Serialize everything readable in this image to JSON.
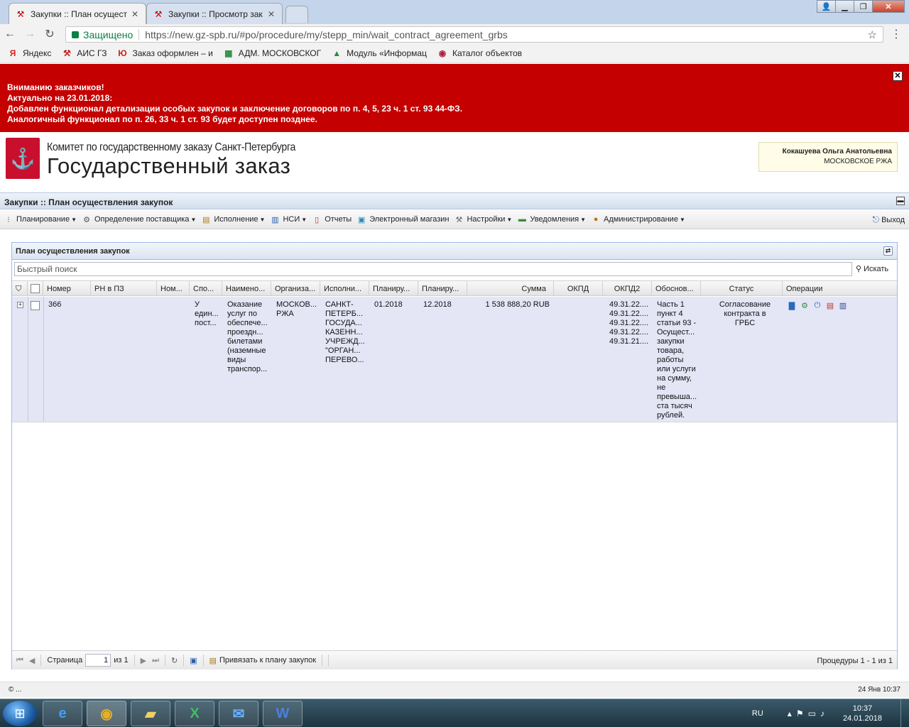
{
  "browser": {
    "tabs": [
      {
        "title": "Закупки :: План осущест",
        "icon": "tools-icon",
        "active": true
      },
      {
        "title": "Закупки :: Просмотр зак",
        "icon": "tools-icon",
        "active": false
      }
    ],
    "secure_label": "Защищено",
    "url": "https://new.gz-spb.ru/#po/procedure/my/stepp_min/wait_contract_agreement_grbs",
    "bookmarks": [
      {
        "label": "Яндекс",
        "icon": "yandex-icon",
        "glyph": "Я",
        "color": "#e02020"
      },
      {
        "label": "АИС ГЗ",
        "icon": "tools-icon",
        "glyph": "⚒",
        "color": "#c02020"
      },
      {
        "label": "Заказ оформлен – и",
        "icon": "yu-icon",
        "glyph": "Ю",
        "color": "#d02020"
      },
      {
        "label": "АДМ. МОСКОВСКОГ",
        "icon": "sheet-icon",
        "glyph": "▦",
        "color": "#2a8a3a"
      },
      {
        "label": "Модуль «Информац",
        "icon": "drive-icon",
        "glyph": "▲",
        "color": "#2a8a3a"
      },
      {
        "label": "Каталог объектов",
        "icon": "catalog-icon",
        "glyph": "◉",
        "color": "#b02040"
      }
    ]
  },
  "banner": {
    "line1": "Вниманию заказчиков!",
    "line2": "Актуально на 23.01.2018:",
    "line3": "Добавлен функционал детализации особых закупок и заключение договоров по п. 4, 5, 23 ч. 1 ст. 93 44-ФЗ.",
    "line4": "Аналогичный функционал по п. 26, 33 ч. 1 ст. 93 будет доступен позднее."
  },
  "header": {
    "org_line": "Комитет по государственному заказу Санкт-Петербурга",
    "product": "Государственный заказ",
    "user_name": "Кокашуева Ольга Анатольевна",
    "user_org": "МОСКОВСКОЕ РЖА"
  },
  "module_title": "Закупки :: План осуществления закупок",
  "toolbar": {
    "items": [
      {
        "label": "Планирование",
        "icon": "planning-icon",
        "glyph": "⁝",
        "dropdown": true
      },
      {
        "label": "Определение поставщика",
        "icon": "gear-icon",
        "glyph": "⚙",
        "dropdown": true
      },
      {
        "label": "Исполнение",
        "icon": "execution-icon",
        "glyph": "▤",
        "dropdown": true
      },
      {
        "label": "НСИ",
        "icon": "book-icon",
        "glyph": "▥",
        "dropdown": true
      },
      {
        "label": "Отчеты",
        "icon": "report-icon",
        "glyph": "▯",
        "dropdown": false
      },
      {
        "label": "Электронный магазин",
        "icon": "cart-icon",
        "glyph": "▣",
        "dropdown": false
      },
      {
        "label": "Настройки",
        "icon": "wrench-icon",
        "glyph": "⚒",
        "dropdown": true
      },
      {
        "label": "Уведомления",
        "icon": "notification-icon",
        "glyph": "▬",
        "dropdown": true
      },
      {
        "label": "Администрирование",
        "icon": "user-icon",
        "glyph": "●",
        "dropdown": true
      }
    ],
    "exit_label": "Выход"
  },
  "panel": {
    "title": "План осуществления закупок",
    "search_placeholder": "Быстрый поиск",
    "search_button": "Искать"
  },
  "grid": {
    "columns": [
      "Номер",
      "РН в ПЗ",
      "Ном...",
      "Спо...",
      "Наимено...",
      "Организа...",
      "Исполни...",
      "Планиру...",
      "Планиру...",
      "Сумма",
      "ОКПД",
      "ОКПД2",
      "Обоснов...",
      "Статус",
      "Операции"
    ],
    "rows": [
      {
        "number": "366",
        "rn": "",
        "nom": "",
        "method": "У един... пост...",
        "name": "Оказание услуг по обеспече... проездн... билетами (наземные виды транспор...",
        "org": "МОСКОВ... РЖА",
        "executor": "САНКТ-ПЕТЕРБ... ГОСУДА... КАЗЕНН... УЧРЕЖД... \"ОРГАН... ПЕРЕВО...",
        "plan_start": "01.2018",
        "plan_end": "12.2018",
        "sum": "1 538 888,20 RUB",
        "okpd": "",
        "okpd2": "49.31.22.... 49.31.22.... 49.31.22.... 49.31.22.... 49.31.21....",
        "basis": "Часть 1 пункт 4 статьи 93 - Осущест... закупки товара, работы или услуги на сумму, не превыша... ста тысяч рублей.",
        "status": "Согласование контракта в ГРБС"
      }
    ]
  },
  "paging": {
    "page_label": "Страница",
    "page_value": "1",
    "of_label": "из 1",
    "bind_label": "Привязать к плану закупок",
    "total": "Процедуры 1 - 1 из 1"
  },
  "statusbar": {
    "left": "© ...",
    "right": "24 Янв 10:37"
  },
  "taskbar": {
    "lang": "RU",
    "time": "10:37",
    "date": "24.01.2018"
  }
}
